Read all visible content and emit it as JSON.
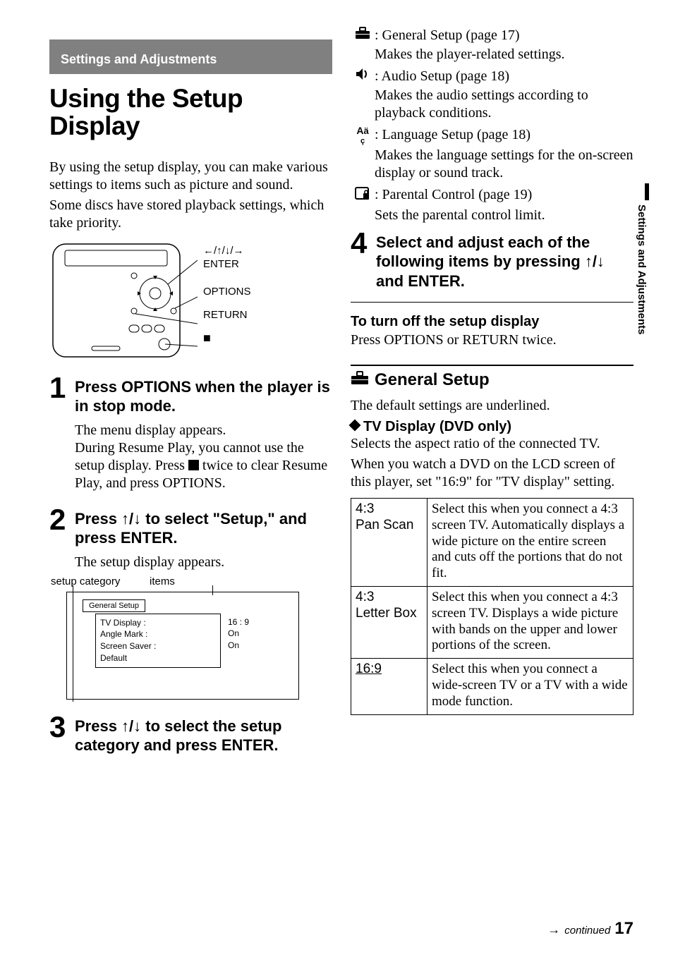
{
  "header": {
    "section_title": "Settings and Adjustments"
  },
  "title": "Using the Setup Display",
  "intro_para1": "By using the setup display, you can make various settings to items such as picture and sound.",
  "intro_para2": "Some discs have stored playback settings, which take priority.",
  "remote_labels": {
    "arrows": "←/↑/↓/→",
    "enter": "ENTER",
    "options": "OPTIONS",
    "return": "RETURN",
    "stop": "■"
  },
  "steps": [
    {
      "num": "1",
      "title": "Press OPTIONS when the player is in stop mode.",
      "text1": "The menu display appears.",
      "text2a": "During Resume Play, you cannot use the setup display. Press ",
      "text2b": " twice to clear Resume Play, and press OPTIONS."
    },
    {
      "num": "2",
      "title": "Press ↑/↓ to select \"Setup,\" and press ENTER.",
      "text1": "The setup display appears."
    },
    {
      "num": "3",
      "title": "Press ↑/↓ to select the setup category and press ENTER."
    },
    {
      "num": "4",
      "title": "Select and adjust each of the following items by pressing ↑/↓ and ENTER."
    }
  ],
  "setup_labels": {
    "category": "setup category",
    "items": "items"
  },
  "setup_preview": {
    "tab": "General Setup",
    "rows": [
      {
        "k": "TV Display :",
        "v": "16 : 9"
      },
      {
        "k": "Angle Mark :",
        "v": "On"
      },
      {
        "k": "Screen Saver :",
        "v": "On"
      },
      {
        "k": "Default",
        "v": ""
      }
    ]
  },
  "categories": [
    {
      "icon": "toolbox",
      "title": ": General Setup (page 17)",
      "desc": "Makes the player-related settings."
    },
    {
      "icon": "speaker",
      "title": ": Audio Setup (page 18)",
      "desc": "Makes the audio settings according to playback conditions."
    },
    {
      "icon": "lang",
      "title": ": Language Setup (page 18)",
      "desc": "Makes the language settings for the on-screen display or sound track."
    },
    {
      "icon": "lock",
      "title": ": Parental Control (page 19)",
      "desc": "Sets the parental control limit."
    }
  ],
  "turnoff": {
    "h": "To turn off the setup display",
    "p": "Press OPTIONS or RETURN twice."
  },
  "general_setup": {
    "h": "General Setup",
    "p": "The default settings are underlined.",
    "tv_display": {
      "h": "TV Display (DVD only)",
      "p1": "Selects the aspect ratio of the connected TV.",
      "p2": "When you watch a DVD on the LCD screen of this player, set \"16:9\" for \"TV display\" setting."
    },
    "options": [
      {
        "k": "4:3\nPan Scan",
        "v": "Select this when you connect a 4:3 screen TV. Automatically displays a wide picture on the entire screen and cuts off the portions that do not fit."
      },
      {
        "k": "4:3\nLetter Box",
        "v": "Select this when you connect a 4:3 screen TV. Displays a wide picture with bands on the upper and lower portions of the screen."
      },
      {
        "k": "16:9",
        "v": "Select this when you connect a wide-screen TV or a TV with a wide mode function."
      }
    ]
  },
  "side_tab": "Settings and Adjustments",
  "footer": {
    "arrow": "→",
    "cont": "continued",
    "page": "17"
  }
}
